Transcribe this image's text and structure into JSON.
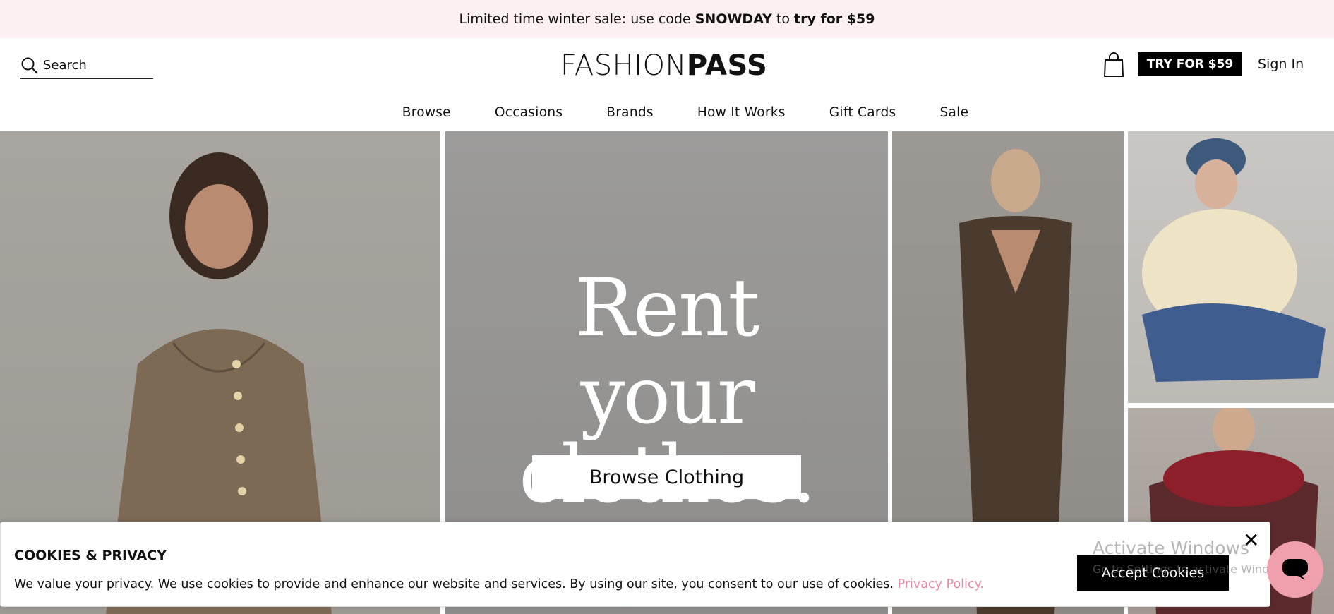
{
  "promo": {
    "prefix": "Limited time winter sale: use code ",
    "code": "SNOWDAY",
    "middle": " to ",
    "offer": "try for $59"
  },
  "header": {
    "search_placeholder": "Search",
    "logo_light": "FASHION",
    "logo_bold": "PASS",
    "try_button": "TRY FOR $59",
    "sign_in": "Sign In"
  },
  "nav": [
    "Browse",
    "Occasions",
    "Brands",
    "How It Works",
    "Gift Cards",
    "Sale"
  ],
  "hero": {
    "title_line1": "Rent",
    "title_line2": "your clothes.",
    "cta": "Browse Clothing"
  },
  "cookie": {
    "title": "COOKIES & PRIVACY",
    "text": "We value your privacy. We use cookies to provide and enhance our website and services. By using our site, you consent to our use of cookies. ",
    "link": "Privacy Policy.",
    "accept": "Accept Cookies",
    "close": "✕"
  },
  "watermark": {
    "line1": "Activate Windows",
    "line2": "Go to Settings to activate Windows."
  }
}
